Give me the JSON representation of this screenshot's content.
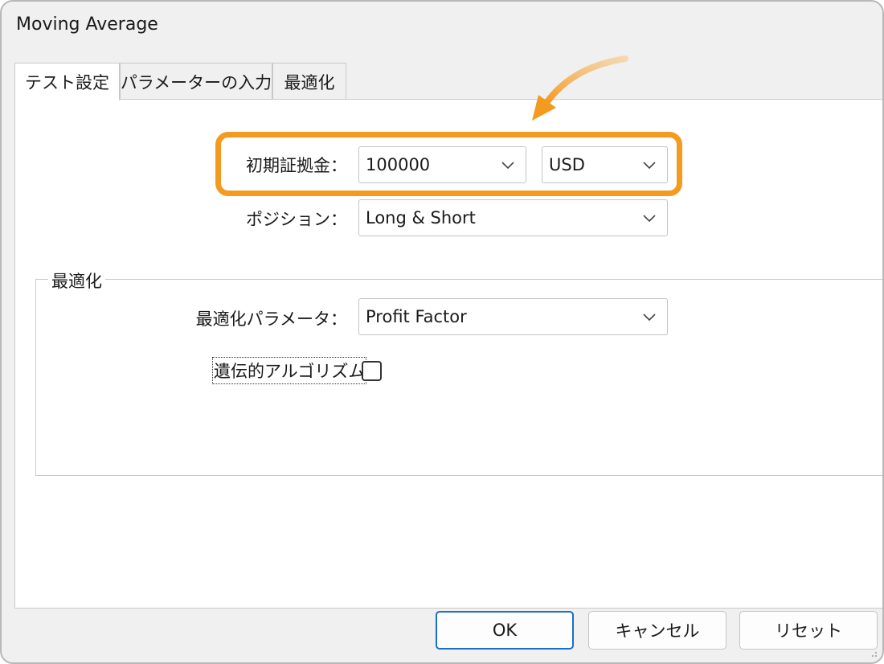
{
  "window": {
    "title": "Moving Average"
  },
  "tabs": [
    {
      "label": "テスト設定",
      "active": true
    },
    {
      "label": "パラメーターの入力",
      "active": false
    },
    {
      "label": "最適化",
      "active": false
    }
  ],
  "settings": {
    "initial_margin_label": "初期証拠金：",
    "initial_margin_value": "100000",
    "currency_value": "USD",
    "position_label": "ポジション：",
    "position_value": "Long & Short"
  },
  "optimization": {
    "group_title": "最適化",
    "param_label": "最適化パラメータ：",
    "param_value": "Profit Factor",
    "genetic_label": "遺伝的アルゴリズム",
    "genetic_checked": false
  },
  "buttons": {
    "ok": "OK",
    "cancel": "キャンセル",
    "reset": "リセット"
  },
  "colors": {
    "highlight": "#f39a1f",
    "default_button_border": "#1b6fc8"
  }
}
